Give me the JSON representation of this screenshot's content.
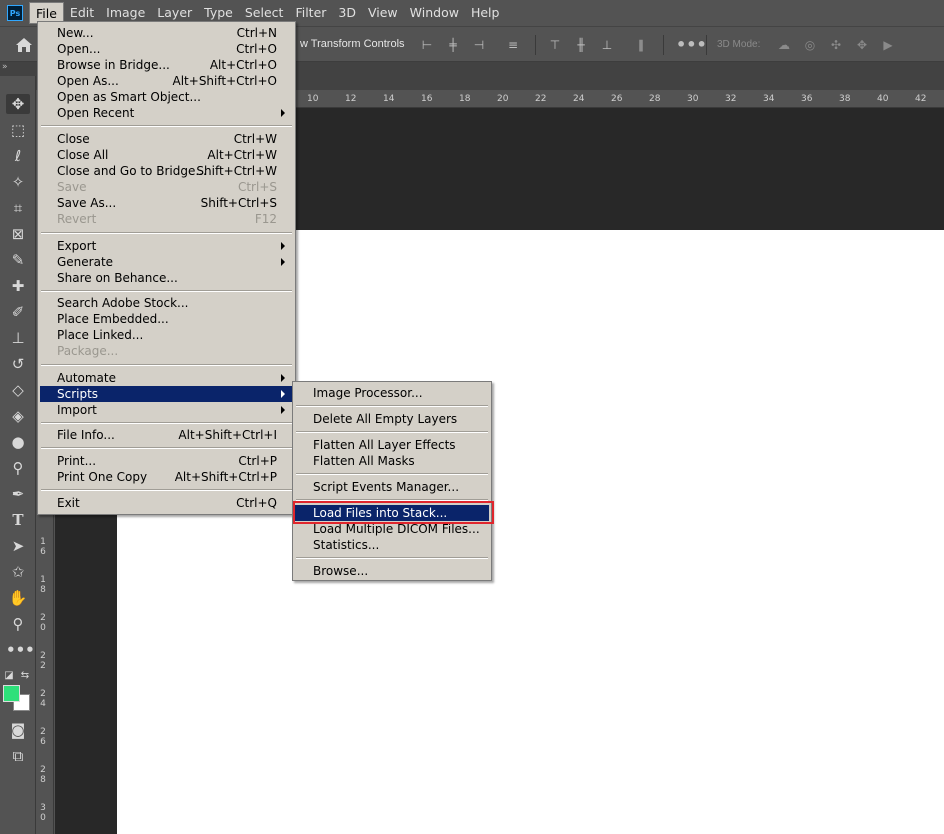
{
  "menubar": {
    "logo": "Ps",
    "items": [
      "File",
      "Edit",
      "Image",
      "Layer",
      "Type",
      "Select",
      "Filter",
      "3D",
      "View",
      "Window",
      "Help"
    ]
  },
  "options_bar": {
    "show_transform": "w Transform Controls",
    "mode_3d": "3D Mode:"
  },
  "ruler": {
    "h_ticks": [
      "10",
      "12",
      "14",
      "16",
      "18",
      "20",
      "22",
      "24",
      "26",
      "28",
      "30",
      "32",
      "34",
      "36",
      "38",
      "40",
      "42"
    ],
    "v_ticks": [
      "1\n6",
      "1\n8",
      "2\n0",
      "2\n2",
      "2\n4",
      "2\n6",
      "2\n8",
      "3\n0"
    ]
  },
  "colors": {
    "foreground": "#2ee07a",
    "background": "#ffffff",
    "highlight": "#0a246a",
    "focus_box": "#e0262d"
  },
  "file_menu": {
    "items": [
      {
        "label": "New...",
        "shortcut": "Ctrl+N"
      },
      {
        "label": "Open...",
        "shortcut": "Ctrl+O"
      },
      {
        "label": "Browse in Bridge...",
        "shortcut": "Alt+Ctrl+O"
      },
      {
        "label": "Open As...",
        "shortcut": "Alt+Shift+Ctrl+O"
      },
      {
        "label": "Open as Smart Object...",
        "shortcut": ""
      },
      {
        "label": "Open Recent",
        "shortcut": ""
      },
      {
        "label": "Close",
        "shortcut": "Ctrl+W"
      },
      {
        "label": "Close All",
        "shortcut": "Alt+Ctrl+W"
      },
      {
        "label": "Close and Go to Bridge...",
        "shortcut": "Shift+Ctrl+W"
      },
      {
        "label": "Save",
        "shortcut": "Ctrl+S"
      },
      {
        "label": "Save As...",
        "shortcut": "Shift+Ctrl+S"
      },
      {
        "label": "Revert",
        "shortcut": "F12"
      },
      {
        "label": "Export",
        "shortcut": ""
      },
      {
        "label": "Generate",
        "shortcut": ""
      },
      {
        "label": "Share on Behance...",
        "shortcut": ""
      },
      {
        "label": "Search Adobe Stock...",
        "shortcut": ""
      },
      {
        "label": "Place Embedded...",
        "shortcut": ""
      },
      {
        "label": "Place Linked...",
        "shortcut": ""
      },
      {
        "label": "Package...",
        "shortcut": ""
      },
      {
        "label": "Automate",
        "shortcut": ""
      },
      {
        "label": "Scripts",
        "shortcut": ""
      },
      {
        "label": "Import",
        "shortcut": ""
      },
      {
        "label": "File Info...",
        "shortcut": "Alt+Shift+Ctrl+I"
      },
      {
        "label": "Print...",
        "shortcut": "Ctrl+P"
      },
      {
        "label": "Print One Copy",
        "shortcut": "Alt+Shift+Ctrl+P"
      },
      {
        "label": "Exit",
        "shortcut": "Ctrl+Q"
      }
    ]
  },
  "scripts_menu": {
    "items": [
      "Image Processor...",
      "Delete All Empty Layers",
      "Flatten All Layer Effects",
      "Flatten All Masks",
      "Script Events Manager...",
      "Load Files into Stack...",
      "Load Multiple DICOM Files...",
      "Statistics...",
      "Browse..."
    ]
  }
}
